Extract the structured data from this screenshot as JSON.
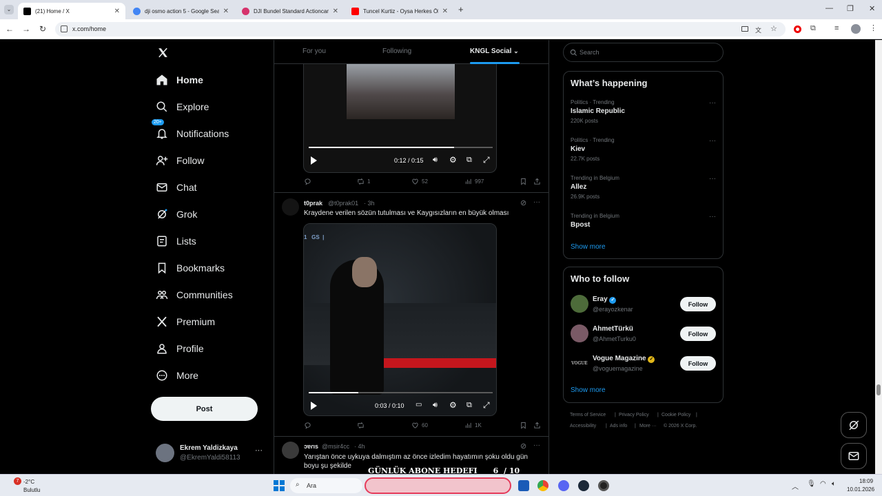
{
  "browser": {
    "tabs": [
      {
        "title": "(21) Home / X",
        "active": true,
        "favicon_color": "#000000"
      },
      {
        "title": "dji osmo action 5 - Google Sea",
        "active": false,
        "favicon_color": "#4285f4"
      },
      {
        "title": "DJI Bundel Standard Actioncam",
        "active": false,
        "favicon_color": "#d6336c"
      },
      {
        "title": "Tuncel Kurtiz - Oysa Herkes Öl",
        "active": false,
        "favicon_color": "#ff0000"
      }
    ],
    "new_tab": "+",
    "url": "x.com/home"
  },
  "nav": {
    "items": [
      {
        "label": "Home",
        "icon": "home-icon",
        "bold": true
      },
      {
        "label": "Explore",
        "icon": "search-icon"
      },
      {
        "label": "Notifications",
        "icon": "bell-icon",
        "badge": "20+"
      },
      {
        "label": "Follow",
        "icon": "add-person-icon"
      },
      {
        "label": "Chat",
        "icon": "mail-icon"
      },
      {
        "label": "Grok",
        "icon": "grok-icon"
      },
      {
        "label": "Lists",
        "icon": "list-icon"
      },
      {
        "label": "Bookmarks",
        "icon": "bookmark-icon"
      },
      {
        "label": "Communities",
        "icon": "people-icon"
      },
      {
        "label": "Premium",
        "icon": "x-logo-icon"
      },
      {
        "label": "Profile",
        "icon": "person-icon"
      },
      {
        "label": "More",
        "icon": "more-circle-icon"
      }
    ],
    "post_button": "Post",
    "account": {
      "name": "Ekrem Yaldizkaya",
      "handle": "@EkremYaldi58113"
    }
  },
  "feed": {
    "tabs": [
      "For you",
      "Following",
      "KNGL Social"
    ],
    "post1": {
      "video_time": "0:12 / 0:15",
      "video_progress": 0.79,
      "stats": {
        "replies": "",
        "reposts": "1",
        "likes": "52",
        "views": "997"
      }
    },
    "post2": {
      "author": "t0prak",
      "handle": "@t0prak01",
      "time": "· 3h",
      "text": "Kraydene verilen sözün tutulması ve Kaygısızların en büyük olması",
      "video_overlay": "1   GS  |",
      "video_time": "0:03 / 0:10",
      "video_progress": 0.27,
      "stats": {
        "replies": "",
        "reposts": "",
        "likes": "60",
        "views": "1K"
      }
    },
    "post3": {
      "author": "ɔɐɾıs",
      "handle": "@msir4cc",
      "time": "· 4h",
      "text": "Yarıştan önce uykuya dalmıştım az önce izledim hayatımın şoku oldu gün boyu şu şekilde",
      "overlay": "GÜNLÜK ABONE HEDEFI      6  / 10"
    }
  },
  "right": {
    "search_placeholder": "Search",
    "happening": {
      "title": "What’s happening",
      "trends": [
        {
          "category": "Politics · Trending",
          "name": "Islamic Republic",
          "posts": "220K posts"
        },
        {
          "category": "Politics · Trending",
          "name": "Kiev",
          "posts": "22.7K posts"
        },
        {
          "category": "Trending in Belgium",
          "name": "Allez",
          "posts": "26.9K posts"
        },
        {
          "category": "Trending in Belgium",
          "name": "Bpost",
          "posts": ""
        }
      ],
      "show_more": "Show more"
    },
    "who_to_follow": {
      "title": "Who to follow",
      "users": [
        {
          "name": "Eray",
          "handle": "@erayozkenar",
          "verified": "blue",
          "follow": "Follow"
        },
        {
          "name": "AhmetTürkü",
          "handle": "@AhmetTurku0",
          "verified": "",
          "follow": "Follow"
        },
        {
          "name": "Vogue Magazine",
          "handle": "@voguemagazine",
          "verified": "gold",
          "follow": "Follow",
          "avatar_text": "VOGUE"
        }
      ],
      "show_more": "Show more"
    },
    "footer": {
      "links": [
        "Terms of Service",
        "Privacy Policy",
        "Cookie Policy",
        "Accessibility",
        "Ads info",
        "More ···",
        "© 2026 X Corp."
      ]
    }
  },
  "taskbar": {
    "weather_temp": "-2°C",
    "weather_desc": "Bulutlu",
    "weather_badge": "7",
    "search": "Ara",
    "time": "18:09",
    "date": "10.01.2026"
  },
  "colors": {
    "accent": "#1d9bf0",
    "gold": "#e2b719"
  }
}
